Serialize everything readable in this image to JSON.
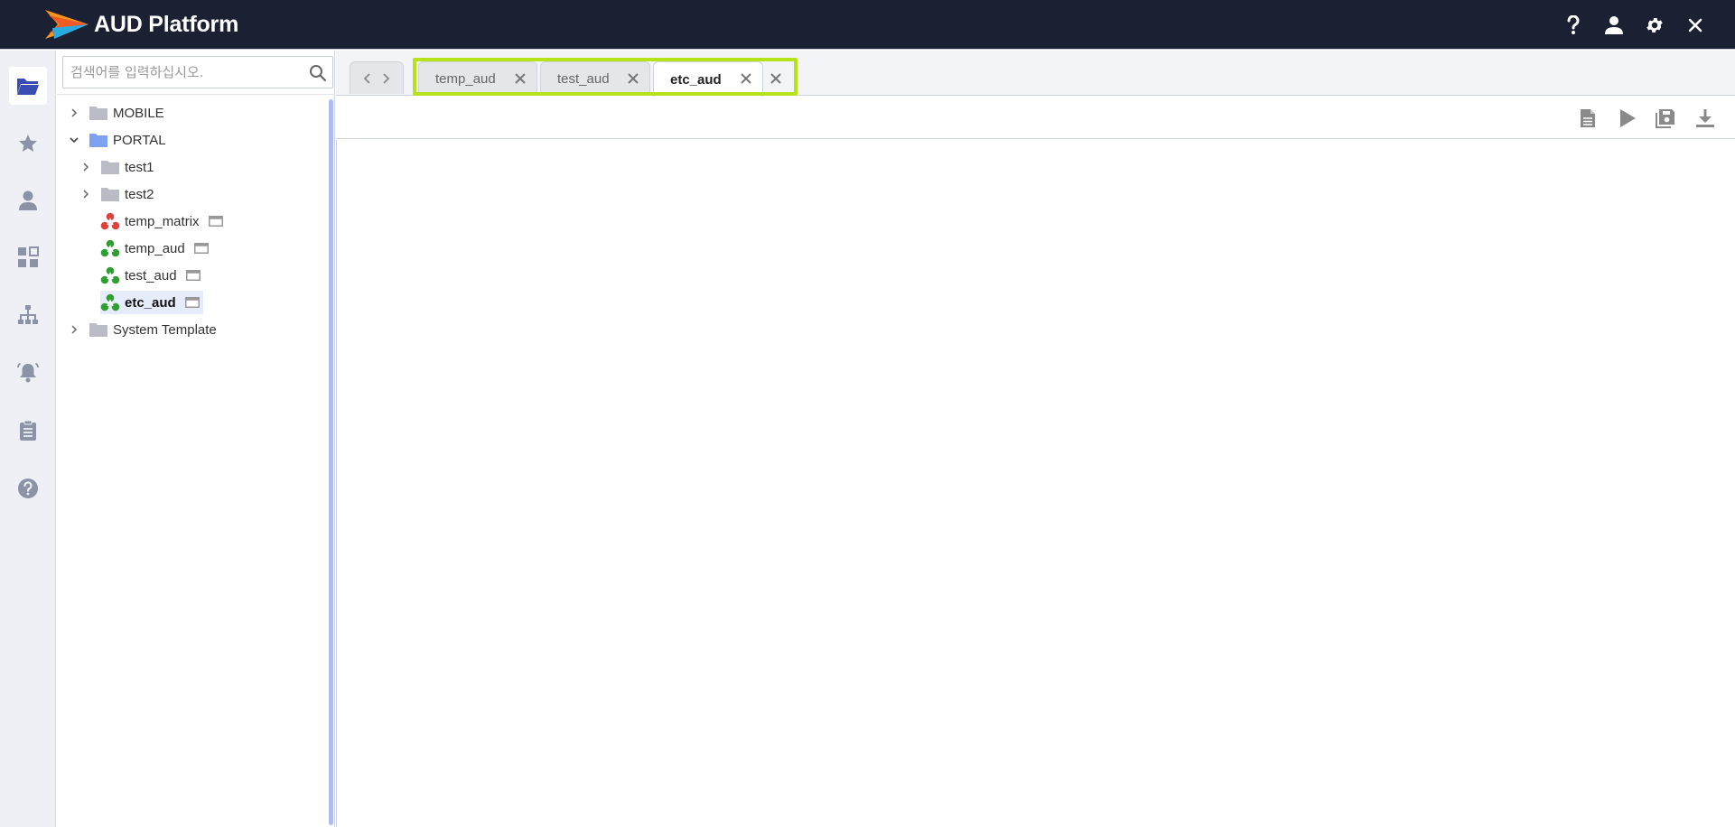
{
  "header": {
    "app_title": "AUD Platform",
    "icons": [
      "help-icon",
      "user-icon",
      "gear-icon",
      "close-icon"
    ]
  },
  "rail": {
    "items": [
      {
        "icon": "folder-icon",
        "active": true
      },
      {
        "icon": "star-icon",
        "active": false
      },
      {
        "icon": "person-icon",
        "active": false
      },
      {
        "icon": "dashboard-icon",
        "active": false
      },
      {
        "icon": "org-chart-icon",
        "active": false
      },
      {
        "icon": "bell-icon",
        "active": false
      },
      {
        "icon": "clipboard-icon",
        "active": false
      },
      {
        "icon": "question-icon",
        "active": false
      }
    ]
  },
  "search": {
    "placeholder": "검색어를 입력하십시오.",
    "value": ""
  },
  "tree": {
    "items": [
      {
        "label": "MOBILE",
        "type": "folder",
        "expanded": false
      },
      {
        "label": "PORTAL",
        "type": "folder",
        "expanded": true
      },
      {
        "label": "test1",
        "type": "folder",
        "expanded": false
      },
      {
        "label": "test2",
        "type": "folder",
        "expanded": false
      },
      {
        "label": "temp_matrix",
        "type": "matrix"
      },
      {
        "label": "temp_aud",
        "type": "aud"
      },
      {
        "label": "test_aud",
        "type": "aud"
      },
      {
        "label": "etc_aud",
        "type": "aud",
        "selected": true
      },
      {
        "label": "System Template",
        "type": "folder",
        "expanded": false
      }
    ]
  },
  "tabs": [
    {
      "label": "temp_aud",
      "active": false
    },
    {
      "label": "test_aud",
      "active": false
    },
    {
      "label": "etc_aud",
      "active": true
    }
  ],
  "toolbar": {
    "buttons": [
      "document-icon",
      "play-icon",
      "save-icon",
      "download-icon"
    ]
  },
  "colors": {
    "header_bg": "#1b2033",
    "tab_highlight": "#b6e219",
    "rail_active": "#3a4db0",
    "matrix_icon": "#e0403a",
    "aud_icon": "#2f9e33",
    "selected_row": "#e6ecfb"
  }
}
